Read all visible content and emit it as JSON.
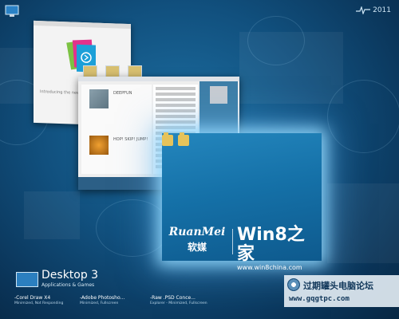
{
  "logo_year": "2011",
  "window_1": {
    "caption": "Introducing the new Windows"
  },
  "window_2": {
    "albums": [
      {
        "title": "DEEPFUN"
      },
      {
        "title": "HOP! SKIP! JUMP!"
      }
    ]
  },
  "active_window": {
    "brand_latin": "RuanMei",
    "brand_cn": "软媒",
    "brand_win8": "Win8之家",
    "brand_url": "www.win8china.com"
  },
  "desktop": {
    "title": "Desktop 3",
    "subtitle": "Applications & Games"
  },
  "tasks": [
    {
      "name": "-Corel Draw X4",
      "status": "Minimized, Not Responding"
    },
    {
      "name": "-Adobe Photosho...",
      "status": "Minimized, Fullscreen"
    },
    {
      "name": "-Raw .PSD Conce...",
      "status": "Explorer - Minimized, Fullscreen"
    }
  ],
  "forum": {
    "name": "过期罐头电脑论坛",
    "url": "www.gqgtpc.com"
  },
  "icons": {
    "corner": "computer-icon",
    "logo": "pulse-icon",
    "folders": [
      "folder-icon",
      "folder-icon"
    ],
    "forum": "forum-logo-icon"
  }
}
